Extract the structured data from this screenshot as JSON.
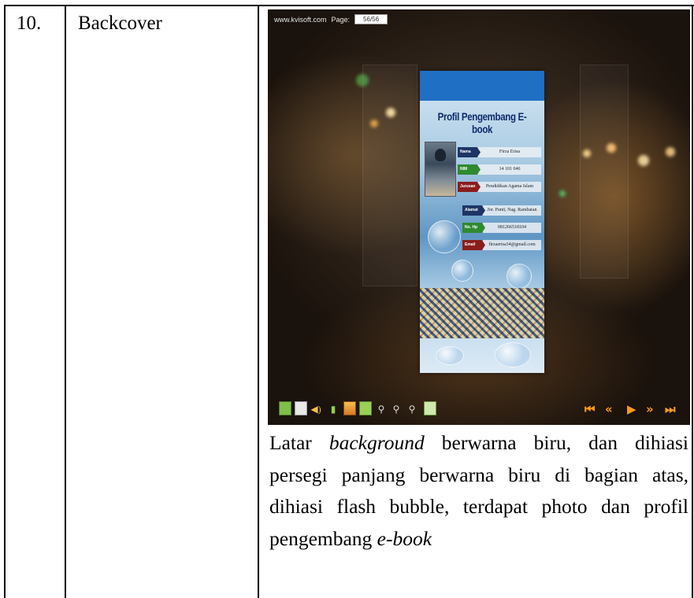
{
  "row": {
    "number": "10.",
    "item": "Backcover"
  },
  "viewer": {
    "site": "www.kvisoft.com",
    "page_label": "Page:",
    "page_value": "56/56",
    "book": {
      "title": "Profil Pengembang E-book",
      "fields": [
        {
          "label": "Nama",
          "value": "Firza Erisa"
        },
        {
          "label": "NIM",
          "value": "14 101 046"
        },
        {
          "label": "Jurusan",
          "value": "Pendidikan Agama Islam"
        },
        {
          "label": "Alamat",
          "value": "Jor. Punti, Nag. Rambatan"
        },
        {
          "label": "No. Hp",
          "value": "081266518104"
        },
        {
          "label": "Email",
          "value": "firzaerisa34@gmail.com"
        }
      ]
    },
    "toolbar_icons": [
      "thumbnails-icon",
      "table-of-contents-icon",
      "sound-icon",
      "bookmark-icon",
      "gallery-icon",
      "print-icon",
      "zoom-in-icon",
      "zoom-out-icon",
      "search-icon",
      "fullscreen-icon"
    ],
    "nav_buttons": [
      "first-page-icon",
      "previous-page-icon",
      "play-icon",
      "next-page-icon",
      "last-page-icon"
    ],
    "colors": {
      "book_header": "#1f6fc4",
      "nav_accent": "#ff9a1a"
    }
  },
  "caption": {
    "part1": "Latar ",
    "part2_italic": "background",
    "part3": " berwarna biru, dan dihiasi persegi panjang berwarna biru di bagian atas, dihiasi flash bubble, terdapat photo dan profil pengembang ",
    "part4_italic": "e-book"
  }
}
